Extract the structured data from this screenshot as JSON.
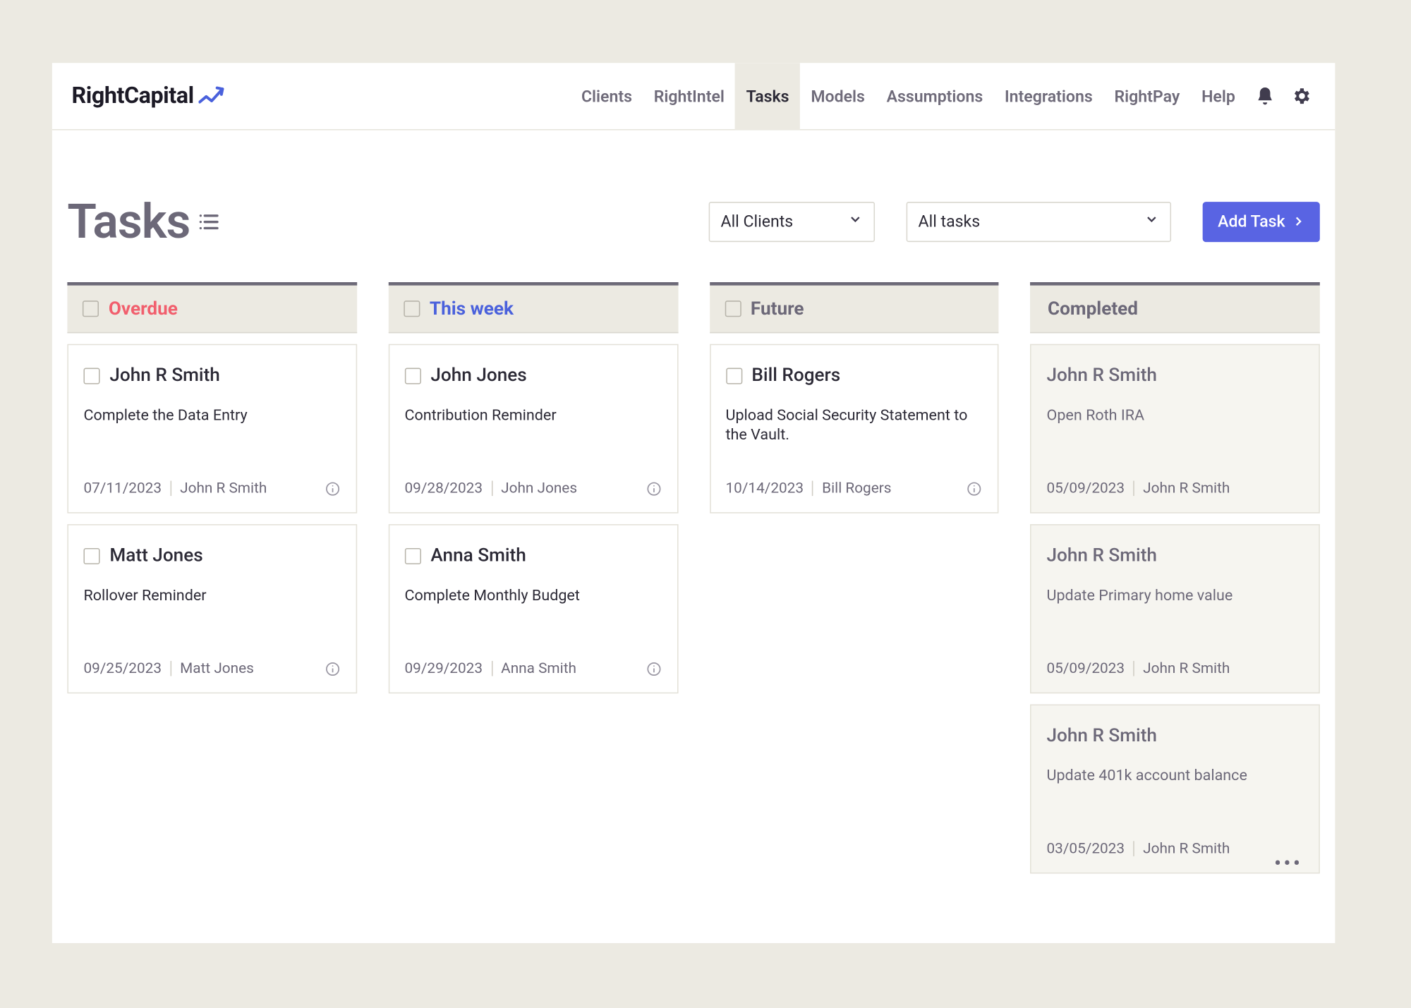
{
  "brand": {
    "name": "RightCapital"
  },
  "nav": {
    "items": [
      {
        "label": "Clients"
      },
      {
        "label": "RightIntel"
      },
      {
        "label": "Tasks",
        "active": true
      },
      {
        "label": "Models"
      },
      {
        "label": "Assumptions"
      },
      {
        "label": "Integrations"
      },
      {
        "label": "RightPay"
      },
      {
        "label": "Help"
      }
    ]
  },
  "page": {
    "title": "Tasks"
  },
  "filters": {
    "clients": "All Clients",
    "task_filter": "All tasks",
    "add_label": "Add Task"
  },
  "columns": {
    "overdue": {
      "label": "Overdue"
    },
    "thisweek": {
      "label": "This week"
    },
    "future": {
      "label": "Future"
    },
    "completed": {
      "label": "Completed"
    }
  },
  "cards": {
    "overdue": [
      {
        "client": "John R Smith",
        "desc": "Complete the Data Entry",
        "date": "07/11/2023",
        "assignee": "John R Smith"
      },
      {
        "client": "Matt Jones",
        "desc": "Rollover Reminder",
        "date": "09/25/2023",
        "assignee": "Matt Jones"
      }
    ],
    "thisweek": [
      {
        "client": "John Jones",
        "desc": "Contribution Reminder",
        "date": "09/28/2023",
        "assignee": "John Jones"
      },
      {
        "client": "Anna Smith",
        "desc": "Complete Monthly Budget",
        "date": "09/29/2023",
        "assignee": "Anna Smith"
      }
    ],
    "future": [
      {
        "client": "Bill Rogers",
        "desc": "Upload Social Security Statement to the Vault.",
        "date": "10/14/2023",
        "assignee": "Bill Rogers"
      }
    ],
    "completed": [
      {
        "client": "John R Smith",
        "desc": "Open Roth IRA",
        "date": "05/09/2023",
        "assignee": "John R Smith"
      },
      {
        "client": "John R Smith",
        "desc": "Update Primary home value",
        "date": "05/09/2023",
        "assignee": "John R Smith"
      },
      {
        "client": "John R Smith",
        "desc": "Update 401k account balance",
        "date": "03/05/2023",
        "assignee": "John R Smith"
      }
    ]
  }
}
